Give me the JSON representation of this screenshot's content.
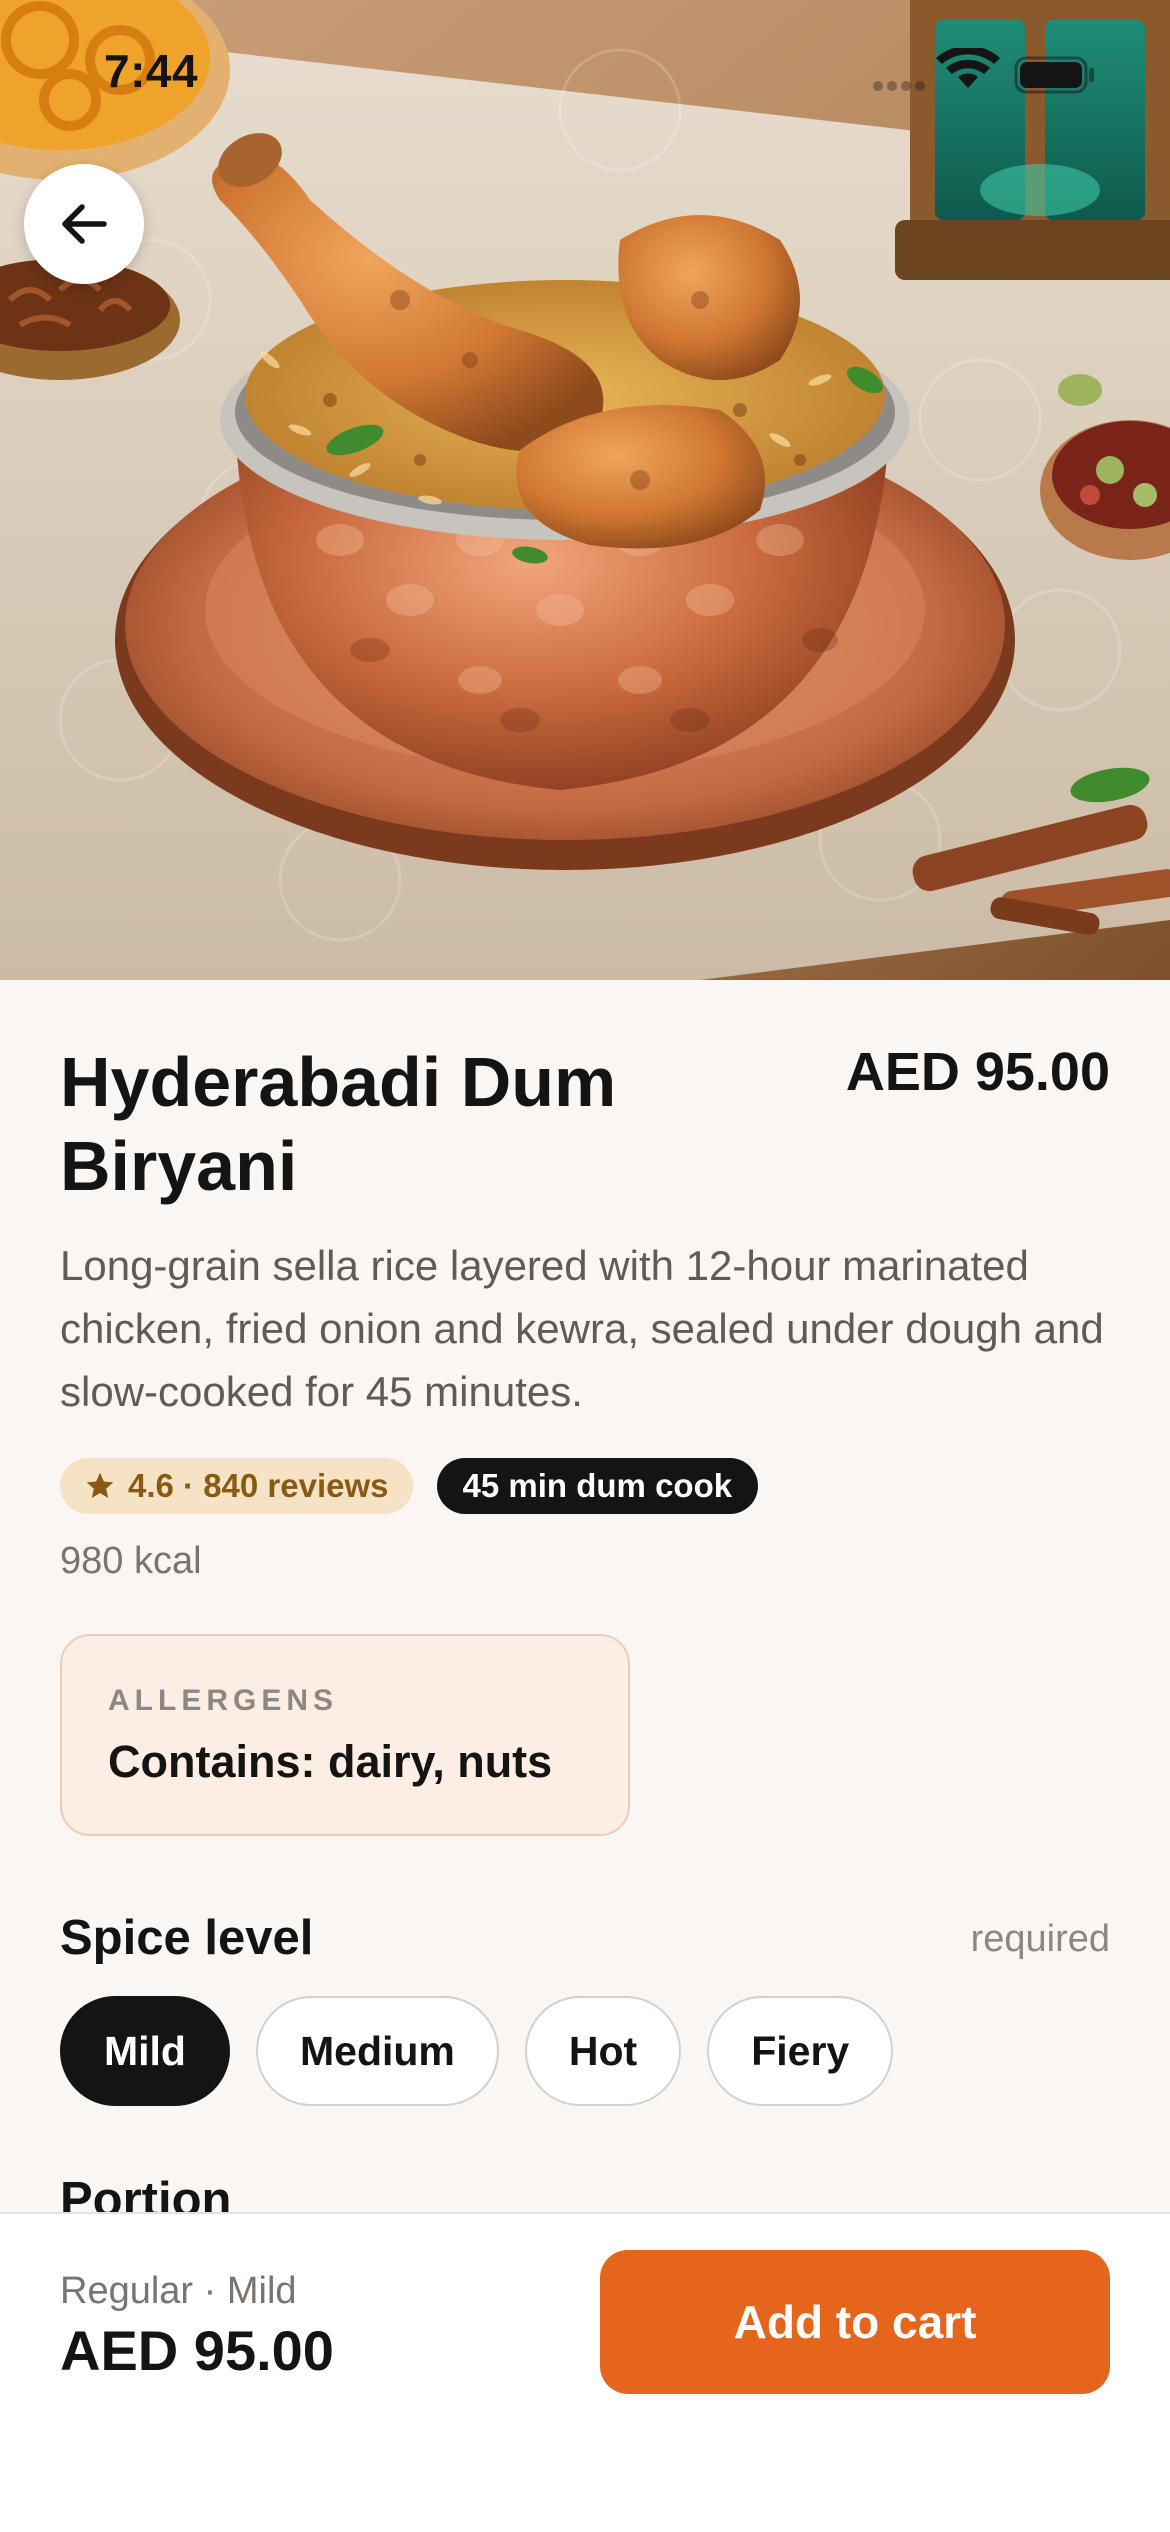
{
  "status_bar": {
    "time": "7:44",
    "icons": [
      "signal-icon",
      "wifi-icon",
      "battery-icon"
    ]
  },
  "hero": {
    "image": "biryani-dish-photo"
  },
  "dish": {
    "name": "Hyderabadi Dum Biryani",
    "price": "AED 95.00",
    "description": "Long-grain sella rice layered with 12-hour marinated chicken, fried onion and kewra, sealed under dough and slow-cooked for 45 minutes.",
    "rating_badge": "4.6 · 840 reviews",
    "cook_badge": "45 min dum cook",
    "calories": "980 kcal"
  },
  "allergens": {
    "label": "ALLERGENS",
    "text": "Contains: dairy, nuts"
  },
  "spice_level": {
    "title": "Spice level",
    "required_label": "required",
    "options": [
      "Mild",
      "Medium",
      "Hot",
      "Fiery"
    ],
    "selected": "Mild"
  },
  "portion": {
    "title": "Portion"
  },
  "bottom_bar": {
    "summary": "Regular · Mild",
    "total": "AED 95.00",
    "add_button": "Add to cart"
  },
  "colors": {
    "accent": "#e5651c",
    "background": "#faf6f3",
    "chip_selected": "#161412",
    "rating_badge_bg": "#f6e3c6",
    "allergen_bg": "#fdeee5"
  }
}
